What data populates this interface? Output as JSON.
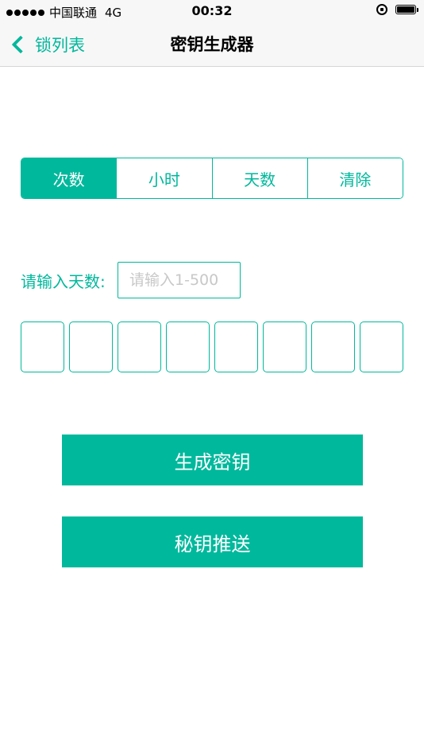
{
  "status_bar": {
    "carrier": "中国联通",
    "network": "4G",
    "time": "00:32"
  },
  "nav": {
    "back_label": "锁列表",
    "title": "密钥生成器"
  },
  "segments": [
    {
      "label": "次数",
      "selected": true
    },
    {
      "label": "小时",
      "selected": false
    },
    {
      "label": "天数",
      "selected": false
    },
    {
      "label": "清除",
      "selected": false
    }
  ],
  "days_input": {
    "label": "请输入天数:",
    "value": "",
    "placeholder": "请输入1-500"
  },
  "code_digits": [
    "",
    "",
    "",
    "",
    "",
    "",
    "",
    ""
  ],
  "buttons": {
    "generate": "生成密钥",
    "push": "秘钥推送"
  },
  "colors": {
    "accent": "#00b89c",
    "nav_background": "#f7f7f7",
    "placeholder": "#c8c8c8"
  },
  "icons": {
    "back": "chevron-left-icon",
    "orientation_lock": "orientation-lock-icon",
    "battery": "battery-icon"
  }
}
